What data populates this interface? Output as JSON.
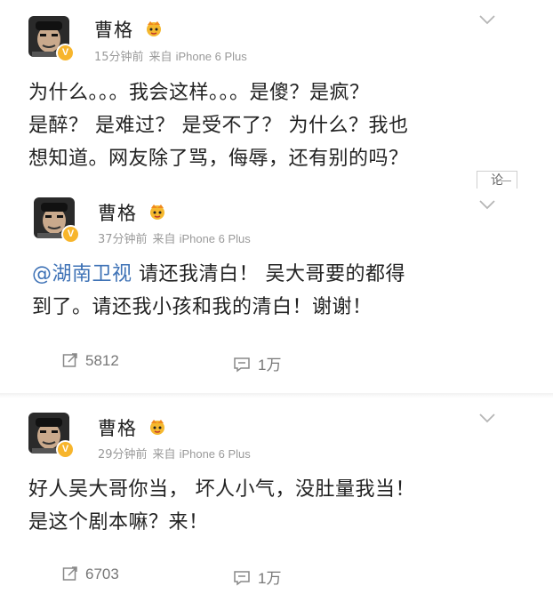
{
  "posts": [
    {
      "author": "曹格",
      "time": "15分钟前",
      "source_label": "来自",
      "device": "iPhone 6 Plus",
      "lines": [
        "为什么。。。我会这样。。。是傻？是疯？",
        "是醉？ 是难过？ 是受不了？ 为什么？我也",
        "想知道。网友除了骂，侮辱，还有别的吗？"
      ],
      "comment_tab": "论"
    },
    {
      "author": "曹格",
      "time": "37分钟前",
      "source_label": "来自",
      "device": "iPhone 6 Plus",
      "mention": "@湖南卫视",
      "line1_rest": "  请还我清白！ 吴大哥要的都得",
      "line2": "到了。请还我小孩和我的清白！谢谢！",
      "reposts": "5812",
      "comments": "1万"
    },
    {
      "author": "曹格",
      "time": "29分钟前",
      "source_label": "来自",
      "device": "iPhone 6 Plus",
      "lines": [
        "好人吴大哥你当， 坏人小气，没肚量我当！",
        "是这个剧本嘛？来！"
      ],
      "reposts": "6703",
      "comments": "1万"
    }
  ],
  "colors": {
    "mention": "#3e72b6",
    "badge": "#f7b52c",
    "meta": "#9a9a9a"
  }
}
